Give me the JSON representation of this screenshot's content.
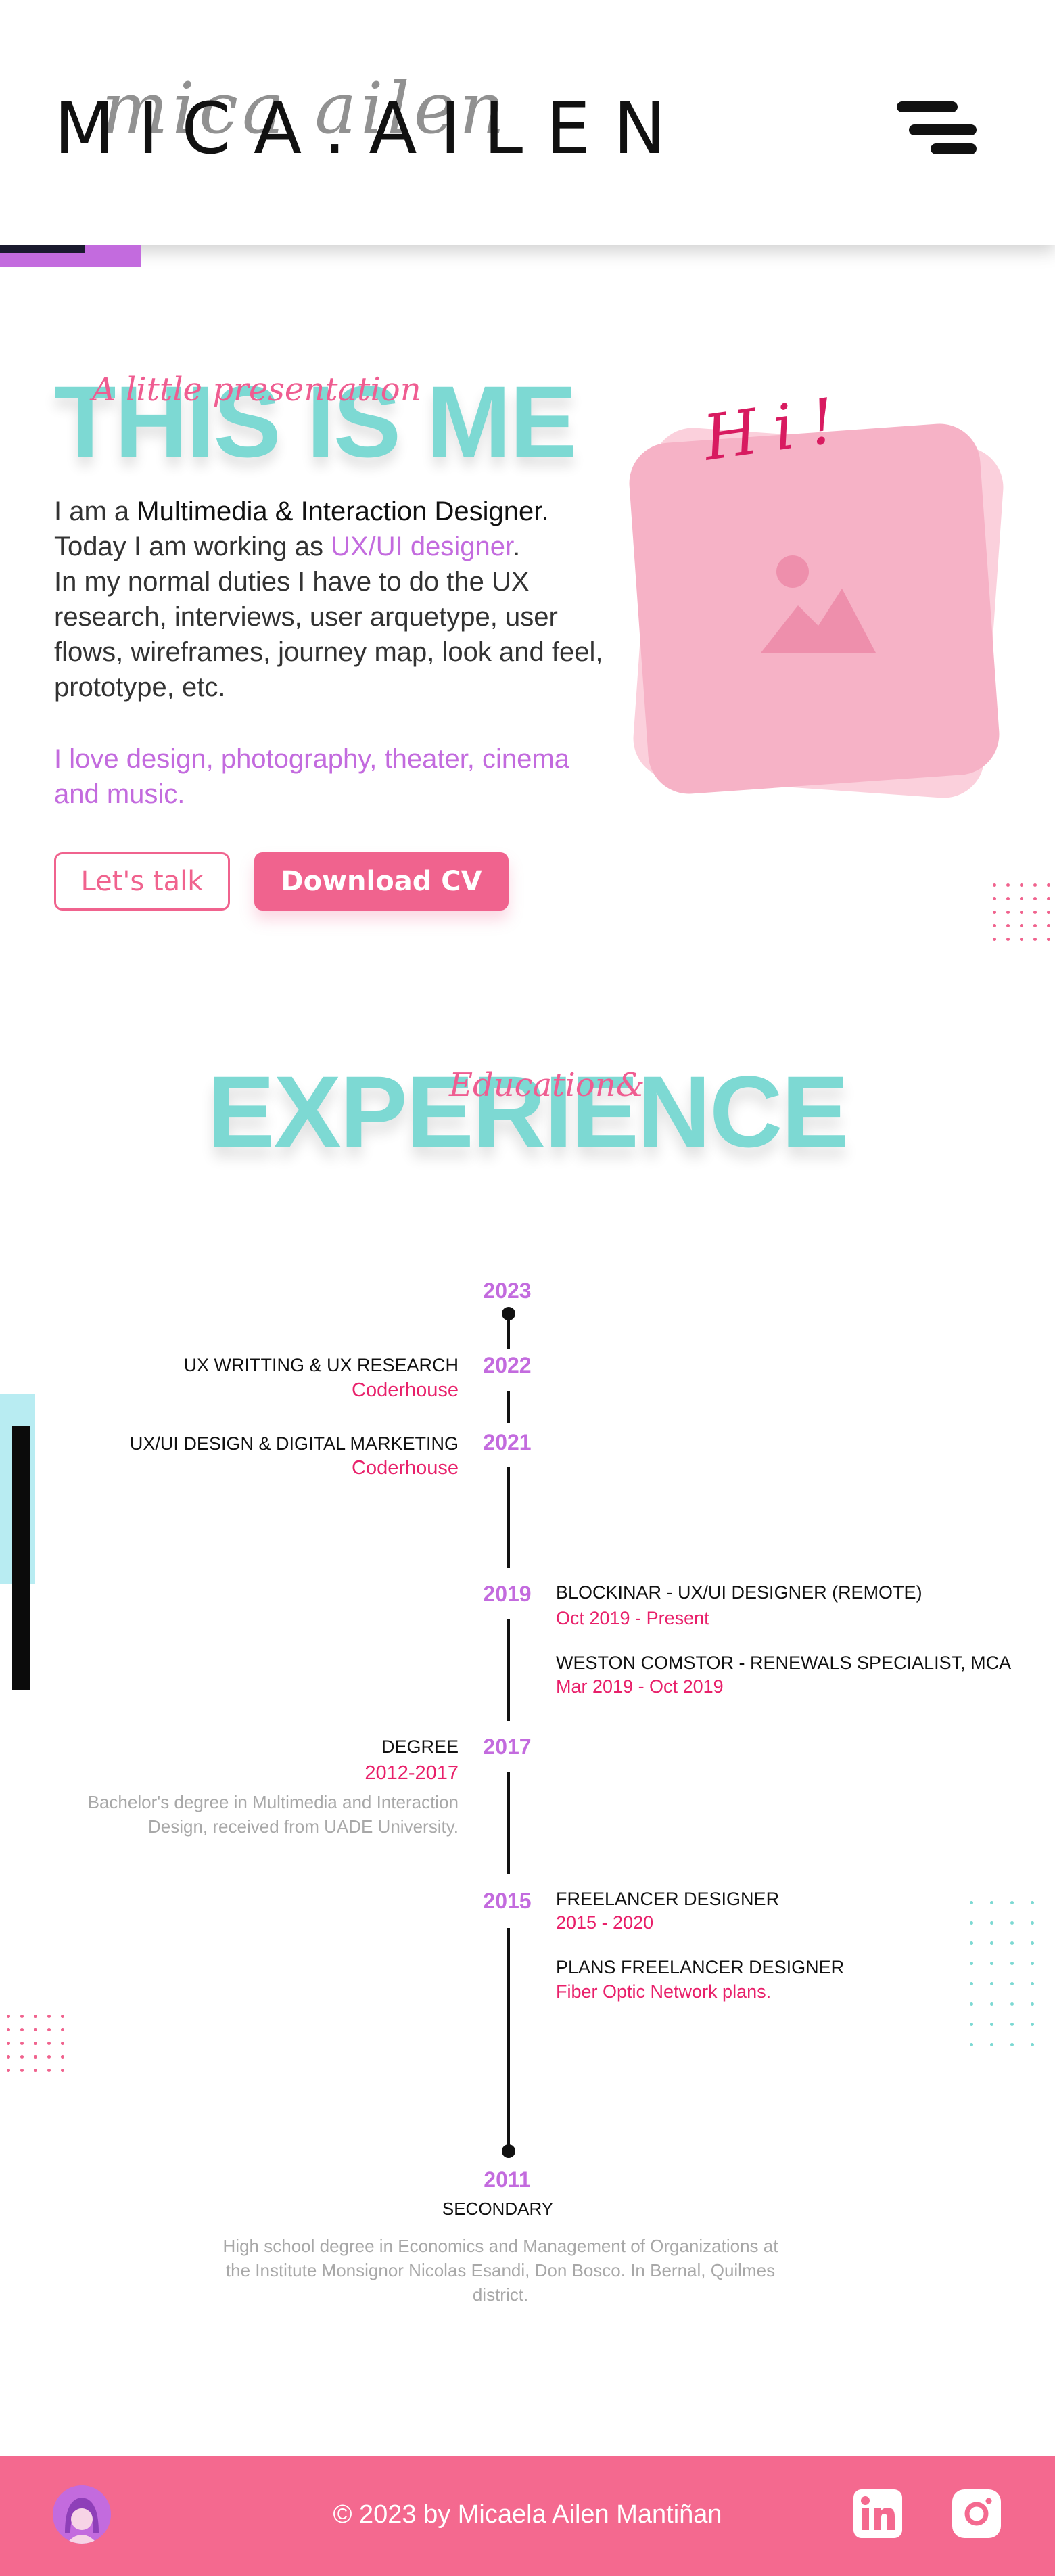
{
  "header": {
    "logo": "MICA.AILEN",
    "logo_script": "mica ailen"
  },
  "about": {
    "title": "THIS IS ME",
    "script": "A little presentation",
    "intro_prefix": "I am a ",
    "intro_role": "Multimedia & Interaction Designer.",
    "working_prefix": "Today I am working as ",
    "working_role": "UX/UI designer",
    "working_suffix": ".",
    "duties": "In my normal duties I have to do the UX research, interviews, user arquetype, user flows, wireframes,  journey map, look and feel, prototype, etc.",
    "love": "I love design, photography, theater, cinema and music.",
    "btn_talk": "Let's talk",
    "btn_cv": "Download CV",
    "hi": "Hi!"
  },
  "experience": {
    "title": "EXPERIENCE",
    "script": "Education&",
    "years": [
      "2023",
      "2022",
      "2021",
      "2019",
      "2017",
      "2015",
      "2011"
    ],
    "items": {
      "ux_writting_title": "UX WRITTING & UX RESEARCH",
      "ux_writting_school": "Coderhouse",
      "uxui_design_title": "UX/UI DESIGN & DIGITAL MARKETING",
      "uxui_design_school": "Coderhouse",
      "blockinar_title": "BLOCKINAR - UX/UI DESIGNER (REMOTE)",
      "blockinar_dates": "Oct 2019 - Present",
      "weston_title": "WESTON COMSTOR - RENEWALS SPECIALIST, MCA",
      "weston_dates": "Mar 2019 - Oct 2019",
      "degree_title": "DEGREE",
      "degree_dates": "2012-2017",
      "degree_desc": "Bachelor's degree in Multimedia and Interaction Design, received from UADE University.",
      "freelancer_title": "FREELANCER DESIGNER",
      "freelancer_dates": "2015 - 2020",
      "plans_title": "PLANS FREELANCER DESIGNER",
      "plans_desc": "Fiber Optic Network plans.",
      "secondary_title": "SECONDARY",
      "secondary_desc": "High school degree in Economics and Management of Organizations at the Institute Monsignor Nicolas Esandi, Don Bosco. In Bernal, Quilmes district."
    }
  },
  "footer": {
    "copyright": "© 2023 by Micaela Ailen Mantiñan",
    "linkedin_icon": "linkedin-icon",
    "instagram_icon": "instagram-icon"
  },
  "colors": {
    "cyan": "#7dd9d3",
    "pink": "#f0638e",
    "purple": "#c36bde",
    "magenta": "#e8206a",
    "footer": "#f4698f"
  }
}
